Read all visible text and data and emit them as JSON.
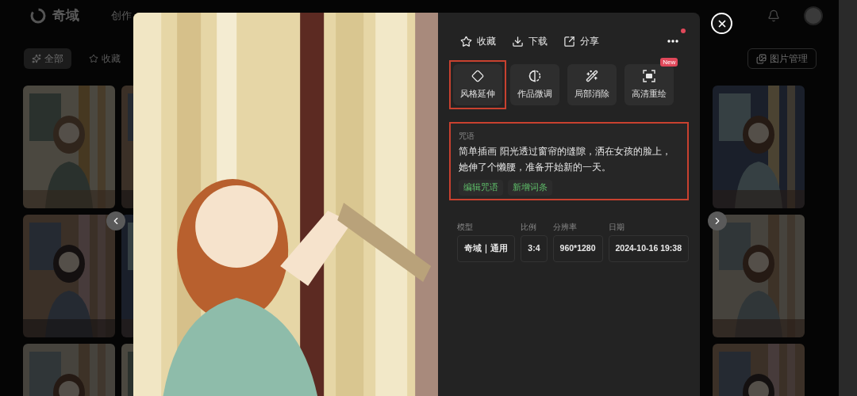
{
  "header": {
    "logo": "奇域",
    "nav": "创作"
  },
  "filters": [
    {
      "label": "全部",
      "selected": true
    },
    {
      "label": "收藏",
      "selected": false
    }
  ],
  "manage_button": "图片管理",
  "viewer": {
    "actions": [
      {
        "label": "收藏"
      },
      {
        "label": "下载"
      },
      {
        "label": "分享"
      }
    ],
    "more_has_dot": true,
    "tools": [
      {
        "label": "风格延伸",
        "highlighted": true
      },
      {
        "label": "作品微调",
        "highlighted": false
      },
      {
        "label": "局部消除",
        "highlighted": false
      },
      {
        "label": "高清重绘",
        "highlighted": false,
        "badge": "New"
      }
    ],
    "prompt": {
      "label": "咒语",
      "text": "简单插画 阳光透过窗帘的缝隙，洒在女孩的脸上，她伸了个懒腰，准备开始新的一天。",
      "highlighted": true,
      "buttons": [
        "编辑咒语",
        "新增词条"
      ]
    },
    "info": [
      {
        "label": "模型",
        "value": "奇域｜通用"
      },
      {
        "label": "比例",
        "value": "3:4"
      },
      {
        "label": "分辨率",
        "value": "960*1280"
      },
      {
        "label": "日期",
        "value": "2024-10-16 19:38"
      }
    ]
  }
}
